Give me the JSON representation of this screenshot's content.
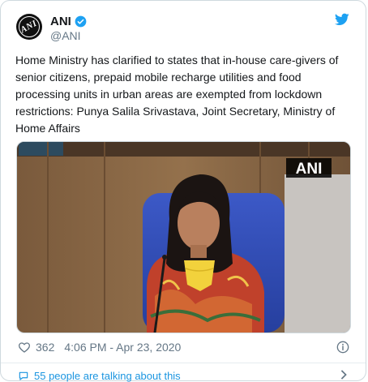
{
  "author": {
    "name": "ANI",
    "handle": "@ANI",
    "avatar_text": "ANI"
  },
  "tweet": {
    "text": "Home Ministry has clarified to states that in-house care-givers of senior citizens, prepaid mobile recharge utilities and food processing units in urban areas are exempted from lockdown restrictions: Punya Salila Srivastava, Joint Secretary, Ministry of Home Affairs"
  },
  "media": {
    "watermark": "ANI"
  },
  "meta": {
    "likes": "362",
    "timestamp": "4:06 PM - Apr 23, 2020"
  },
  "footer": {
    "talking_text": "55 people are talking about this"
  },
  "icons": {
    "verified": "verified-badge-icon",
    "bird": "twitter-bird-icon",
    "heart": "heart-icon",
    "info": "info-icon",
    "talking": "speech-bubble-icon",
    "chevron": "chevron-right-icon"
  },
  "colors": {
    "accent": "#1da1f2",
    "link": "#1b95e0",
    "secondary_text": "#657786"
  }
}
